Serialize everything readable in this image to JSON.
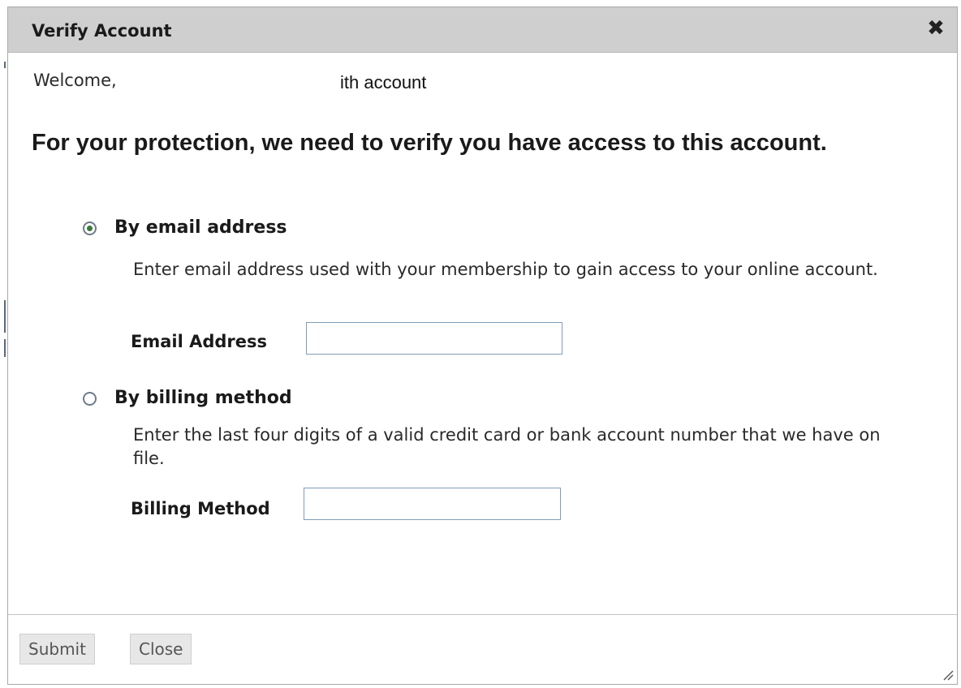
{
  "dialog": {
    "title": "Verify Account",
    "close_icon": "close-icon"
  },
  "welcome": {
    "text": "Welcome,",
    "suffix": "ith account"
  },
  "heading": "For your protection, we need to verify you have access to this account.",
  "options": [
    {
      "label": "By email address",
      "selected": true,
      "description": "Enter email address used with your membership to gain access to your online account.",
      "field_label": "Email Address",
      "field_value": ""
    },
    {
      "label": "By billing method",
      "selected": false,
      "description": "Enter the last four digits of a valid credit card or bank account number that we have on file.",
      "field_label": "Billing Method",
      "field_value": ""
    }
  ],
  "buttons": {
    "submit": "Submit",
    "close": "Close"
  },
  "colors": {
    "titlebar": "#cfcfcf",
    "radio_selected": "#3c7a3c",
    "input_border": "#7f9db9"
  }
}
